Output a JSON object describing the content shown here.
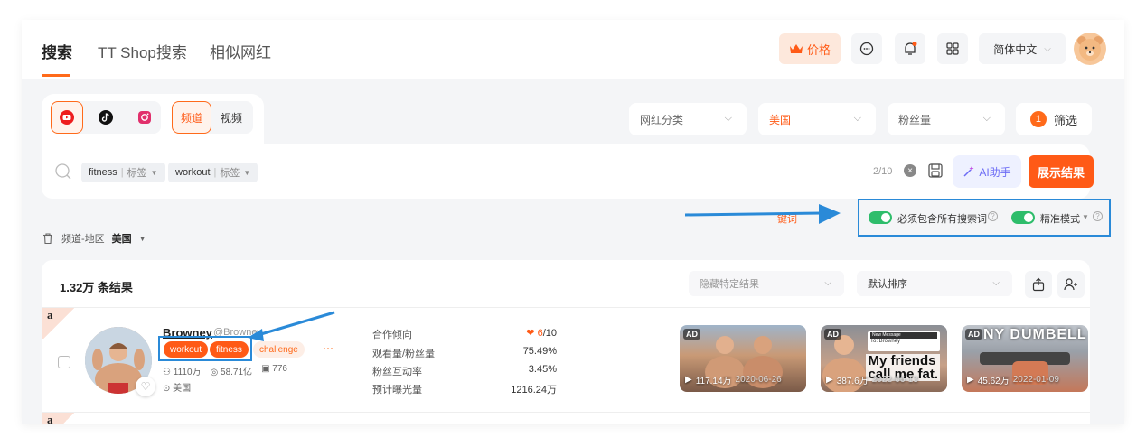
{
  "nav": {
    "tabs": [
      {
        "label": "搜索",
        "active": true
      },
      {
        "label": "TT Shop搜索",
        "active": false
      },
      {
        "label": "相似网红",
        "active": false
      }
    ],
    "price_label": "价格",
    "language": "简体中文"
  },
  "search": {
    "platforms": [
      "youtube-icon",
      "tiktok-icon",
      "instagram-icon"
    ],
    "content_types": [
      {
        "label": "频道",
        "selected": true
      },
      {
        "label": "视频",
        "selected": false
      }
    ],
    "filters": [
      {
        "label": "网红分类",
        "active": false
      },
      {
        "label": "美国",
        "active": true
      },
      {
        "label": "粉丝量",
        "active": false
      }
    ],
    "filter_button": {
      "count": "1",
      "label": "筛选"
    },
    "chips": [
      {
        "keyword": "fitness",
        "type": "标签"
      },
      {
        "keyword": "workout",
        "type": "标签"
      }
    ],
    "counter": "2/10",
    "ai_label": "AI助手",
    "submit_label": "展示结果"
  },
  "options": {
    "keyword_hint": "键词",
    "must_include_label": "必须包含所有搜索词",
    "precise_label": "精准模式",
    "must_include_on": true,
    "precise_on": true
  },
  "region": {
    "label": "频道-地区",
    "value": "美国"
  },
  "results": {
    "count_label": "1.32万 条结果",
    "hide_placeholder": "隐藏特定结果",
    "sort_label": "默认排序",
    "rows": [
      {
        "corner_letter": "a",
        "name": "Browney",
        "handle": "@Browney",
        "tags": [
          {
            "label": "workout",
            "highlight": true
          },
          {
            "label": "fitness",
            "highlight": true
          },
          {
            "label": "challenge",
            "highlight": false
          }
        ],
        "more": "···",
        "followers": "1110万",
        "views": "58.71亿",
        "videos": "776",
        "location": "美国",
        "metrics": [
          {
            "label": "合作倾向",
            "value": "6",
            "suffix": "/10"
          },
          {
            "label": "观看量/粉丝量",
            "value": "75.49%"
          },
          {
            "label": "粉丝互动率",
            "value": "3.45%"
          },
          {
            "label": "预计曝光量",
            "value": "1216.24万"
          }
        ],
        "videos_list": [
          {
            "ad": "AD",
            "views": "117.14万",
            "date": "2020-06-26"
          },
          {
            "ad": "AD",
            "views": "387.6万",
            "date": "2022-06-13",
            "caption_line1": "My friends",
            "caption_line2": "call me fat.",
            "msg_title": "New Message",
            "msg_to": "To: Browney"
          },
          {
            "ad": "AD",
            "views": "45.62万",
            "date": "2022-01-09",
            "headline": "NY DUMBELL"
          }
        ]
      },
      {
        "corner_letter": "a"
      }
    ]
  },
  "colors": {
    "accent": "#ff5a16",
    "highlight_box": "#2a8ad8",
    "toggle_on": "#2ebd6b"
  }
}
